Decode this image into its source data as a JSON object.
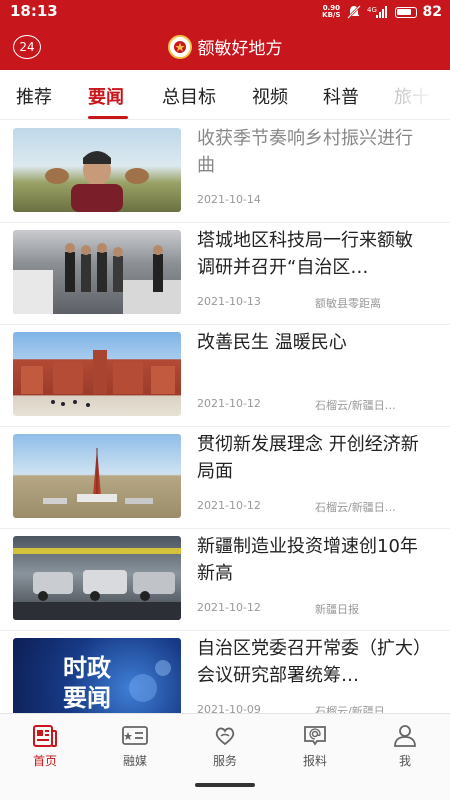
{
  "status_bar": {
    "time": "18:13",
    "net_speed_value": "0.90",
    "net_speed_unit": "KB/S",
    "signal": "4G",
    "battery_level": "82"
  },
  "header": {
    "left_badge": "24",
    "title": "额敏好地方"
  },
  "tabs": [
    {
      "label": "推荐",
      "active": false
    },
    {
      "label": "要闻",
      "active": true
    },
    {
      "label": "总目标",
      "active": false
    },
    {
      "label": "视频",
      "active": false
    },
    {
      "label": "科普",
      "active": false
    },
    {
      "label": "旅十",
      "active": false
    }
  ],
  "news": [
    {
      "title": "收获季节奏响乡村振兴进行曲",
      "date": "2021-10-14",
      "source": "",
      "read": true
    },
    {
      "title": "塔城地区科技局一行来额敏调研并召开“自治区…",
      "date": "2021-10-13",
      "source": "额敏县零距离",
      "read": false
    },
    {
      "title": "改善民生 温暖民心",
      "date": "2021-10-12",
      "source": "石榴云/新疆日…",
      "read": false
    },
    {
      "title": "贯彻新发展理念 开创经济新局面",
      "date": "2021-10-12",
      "source": "石榴云/新疆日…",
      "read": false
    },
    {
      "title": "新疆制造业投资增速创10年新高",
      "date": "2021-10-12",
      "source": "新疆日报",
      "read": false
    },
    {
      "title": "自治区党委召开常委（扩大）会议研究部署统筹…",
      "date": "2021-10-09",
      "source": "石榴云/新疆日…",
      "read": false
    }
  ],
  "thumb6_text": {
    "line1": "时政",
    "line2": "要闻"
  },
  "bottom_nav": [
    {
      "label": "首页",
      "icon": "newspaper-icon",
      "active": true
    },
    {
      "label": "融媒",
      "icon": "media-card-icon",
      "active": false
    },
    {
      "label": "服务",
      "icon": "heart-hands-icon",
      "active": false
    },
    {
      "label": "报料",
      "icon": "at-message-icon",
      "active": false
    },
    {
      "label": "我",
      "icon": "person-icon",
      "active": false
    }
  ],
  "colors": {
    "brand_red": "#c8161d",
    "text": "#222222",
    "muted": "#999999"
  }
}
